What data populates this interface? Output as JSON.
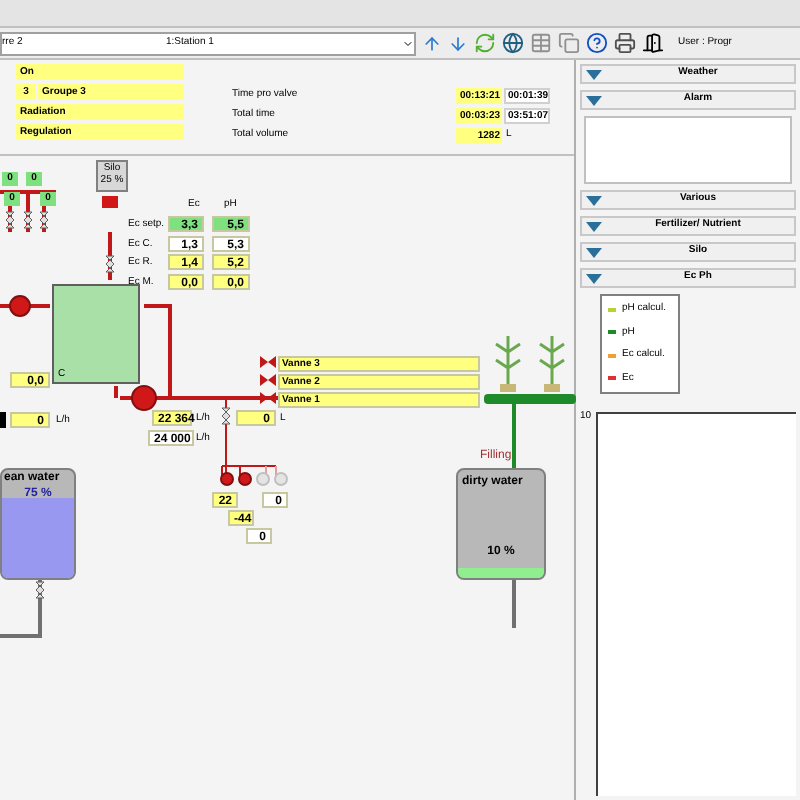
{
  "toolbar": {
    "selector_left": "rre 2",
    "selector_right": "1:Station 1",
    "user": "User : Progr"
  },
  "info": {
    "state": "On",
    "group_number": "3",
    "group": "Groupe 3",
    "lines": [
      "Radiation",
      "Regulation"
    ]
  },
  "timings": [
    {
      "label": "Time pro valve",
      "value": "00:13:21",
      "value_2": "00:01:39"
    },
    {
      "label": "Total time",
      "value": "00:03:23",
      "value_2": "03:51:07"
    },
    {
      "label": "Total volume",
      "value": "1282",
      "unit": "L"
    }
  ],
  "diagram": {
    "sensor_values": [
      "0",
      "0",
      "0",
      "0"
    ],
    "silo": {
      "label": "Silo",
      "level_text": "25 %"
    },
    "ec_ph": {
      "columns": [
        "Ec",
        "pH"
      ],
      "rows": [
        {
          "label": "Ec setp.",
          "ec": "3,3",
          "ph": "5,5",
          "kind": "setpoint"
        },
        {
          "label": "Ec C.",
          "ec": "1,3",
          "ph": "5,3",
          "kind": "current"
        },
        {
          "label": "Ec R.",
          "ec": "1,4",
          "ph": "5,2",
          "kind": "reading"
        },
        {
          "label": "Ec M.",
          "ec": "0,0",
          "ph": "0,0",
          "kind": "reading"
        }
      ]
    },
    "mix_tank_value": "0,0",
    "mix_tank_mark": "C",
    "valves": [
      {
        "label": "Vanne 3"
      },
      {
        "label": "Vanne 2"
      },
      {
        "label": "Vanne 1"
      }
    ],
    "inflow": {
      "value": "0",
      "unit": "L/h"
    },
    "flow": {
      "value": "22 364",
      "unit": "L/h",
      "target": "24 000",
      "target_unit": "L/h"
    },
    "volume": {
      "value": "0",
      "unit": "L"
    },
    "pumps": [
      {
        "on": true
      },
      {
        "on": true
      },
      {
        "on": false
      },
      {
        "on": false
      }
    ],
    "pump_values": [
      {
        "value": "22",
        "kind": "reading"
      },
      {
        "value": "0",
        "kind": "current"
      },
      {
        "value": "-44",
        "kind": "reading"
      },
      {
        "value": "0",
        "kind": "current"
      }
    ],
    "clean_tank": {
      "label": "ean water",
      "level_text": "75 %",
      "level": 0.75
    },
    "dirty_tank": {
      "status": "Filling",
      "label": "dirty water",
      "level_text": "10 %",
      "level": 0.1
    }
  },
  "side_panel": {
    "sections": [
      {
        "title": "Weather"
      },
      {
        "title": "Alarm"
      },
      {
        "title": "Various"
      },
      {
        "title": "Fertilizer/ Nutrient"
      },
      {
        "title": "Silo"
      },
      {
        "title": "Ec Ph"
      }
    ],
    "legend": [
      {
        "label": "pH calcul.",
        "color": "#b5d334"
      },
      {
        "label": "pH",
        "color": "#1f8a2a"
      },
      {
        "label": "Ec calcul.",
        "color": "#f0a030"
      },
      {
        "label": "Ec",
        "color": "#e03030"
      }
    ],
    "chart_axis_label": "10"
  }
}
